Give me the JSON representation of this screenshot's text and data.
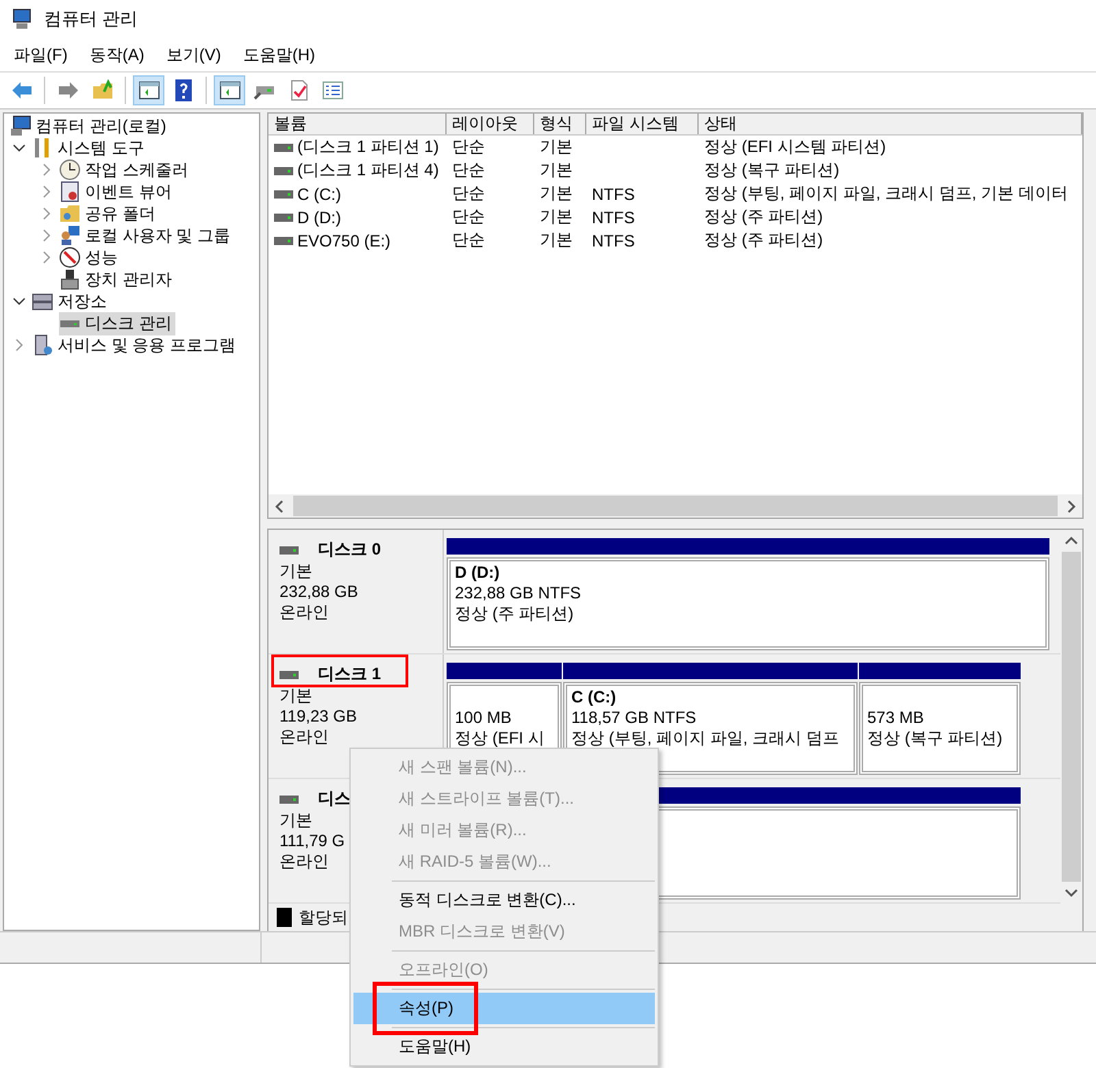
{
  "window": {
    "title": "컴퓨터 관리"
  },
  "menu_bar": [
    "파일(F)",
    "동작(A)",
    "보기(V)",
    "도움말(H)"
  ],
  "toolbar": [
    {
      "pressed": false
    },
    {
      "pressed": false
    },
    {
      "pressed": false
    },
    {
      "pressed": true
    },
    {
      "pressed": false
    },
    {
      "pressed": true
    },
    {
      "pressed": false
    },
    {
      "pressed": false
    },
    {
      "pressed": false
    }
  ],
  "tree": [
    {
      "label": "컴퓨터 관리(로컬)",
      "selected": false,
      "children": [
        {
          "label": "시스템 도구",
          "expanded": true,
          "selected": false,
          "children": [
            {
              "label": "작업 스케줄러",
              "expanded": false,
              "selected": false
            },
            {
              "label": "이벤트 뷰어",
              "expanded": false,
              "selected": false
            },
            {
              "label": "공유 폴더",
              "expanded": false,
              "selected": false
            },
            {
              "label": "로컬 사용자 및 그룹",
              "expanded": false,
              "selected": false
            },
            {
              "label": "성능",
              "expanded": false,
              "selected": false
            },
            {
              "label": "장치 관리자",
              "selected": false
            }
          ]
        },
        {
          "label": "저장소",
          "expanded": true,
          "selected": false,
          "children": [
            {
              "label": "디스크 관리",
              "selected": true
            }
          ]
        },
        {
          "label": "서비스 및 응용 프로그램",
          "expanded": false,
          "selected": false
        }
      ]
    }
  ],
  "volume_table": {
    "columns": [
      "볼륨",
      "레이아웃",
      "형식",
      "파일 시스템",
      "상태"
    ],
    "rows": [
      [
        "(디스크 1 파티션 1)",
        "단순",
        "기본",
        "",
        "정상 (EFI 시스템 파티션)"
      ],
      [
        "(디스크 1 파티션 4)",
        "단순",
        "기본",
        "",
        "정상 (복구 파티션)"
      ],
      [
        "C (C:)",
        "단순",
        "기본",
        "NTFS",
        "정상 (부팅, 페이지 파일, 크래시 덤프, 기본 데이터"
      ],
      [
        "D (D:)",
        "단순",
        "기본",
        "NTFS",
        "정상 (주 파티션)"
      ],
      [
        "EVO750 (E:)",
        "단순",
        "기본",
        "NTFS",
        "정상 (주 파티션)"
      ]
    ]
  },
  "disks": [
    {
      "name": "디스크 0",
      "type": "기본",
      "size": "232,88 GB",
      "status": "온라인",
      "highlighted": false,
      "partitions": [
        {
          "kind": "volume",
          "title": "D  (D:)",
          "size": "232,88 GB NTFS",
          "state": "정상 (주 파티션)"
        }
      ]
    },
    {
      "name": "디스크 1",
      "type": "기본",
      "size": "119,23 GB",
      "status": "온라인",
      "highlighted": true,
      "partitions": [
        {
          "kind": "volume",
          "size": "100 MB",
          "state": "정상 (EFI 시"
        },
        {
          "kind": "volume",
          "title": "C  (C:)",
          "size": "118,57 GB NTFS",
          "state": "정상 (부팅, 페이지 파일, 크래시 덤프"
        },
        {
          "kind": "volume",
          "size": "573 MB",
          "state": "정상 (복구 파티션)"
        }
      ]
    },
    {
      "name": "디스",
      "type": "기본",
      "size": "111,79 G",
      "status": "온라인",
      "highlighted": false,
      "partitions": [
        {
          "kind": "volume"
        }
      ]
    }
  ],
  "legend": [
    {
      "label": "할당되",
      "color": "#000000"
    }
  ],
  "context_menu": [
    {
      "kind": "item",
      "label": "새 스팬 볼륨(N)...",
      "disabled": true,
      "selected": false,
      "highlighted": false
    },
    {
      "kind": "item",
      "label": "새 스트라이프 볼륨(T)...",
      "disabled": true,
      "selected": false,
      "highlighted": false
    },
    {
      "kind": "item",
      "label": "새 미러 볼륨(R)...",
      "disabled": true,
      "selected": false,
      "highlighted": false
    },
    {
      "kind": "item",
      "label": "새 RAID-5 볼륨(W)...",
      "disabled": true,
      "selected": false,
      "highlighted": false
    },
    {
      "kind": "separator"
    },
    {
      "kind": "item",
      "label": "동적 디스크로 변환(C)...",
      "disabled": false,
      "selected": false,
      "highlighted": false
    },
    {
      "kind": "item",
      "label": "MBR 디스크로 변환(V)",
      "disabled": true,
      "selected": false,
      "highlighted": false
    },
    {
      "kind": "separator"
    },
    {
      "kind": "item",
      "label": "오프라인(O)",
      "disabled": true,
      "selected": false,
      "highlighted": false
    },
    {
      "kind": "separator"
    },
    {
      "kind": "item",
      "label": "속성(P)",
      "disabled": false,
      "selected": true,
      "highlighted": true
    },
    {
      "kind": "separator"
    },
    {
      "kind": "item",
      "label": "도움말(H)",
      "disabled": false,
      "selected": false,
      "highlighted": false
    }
  ]
}
